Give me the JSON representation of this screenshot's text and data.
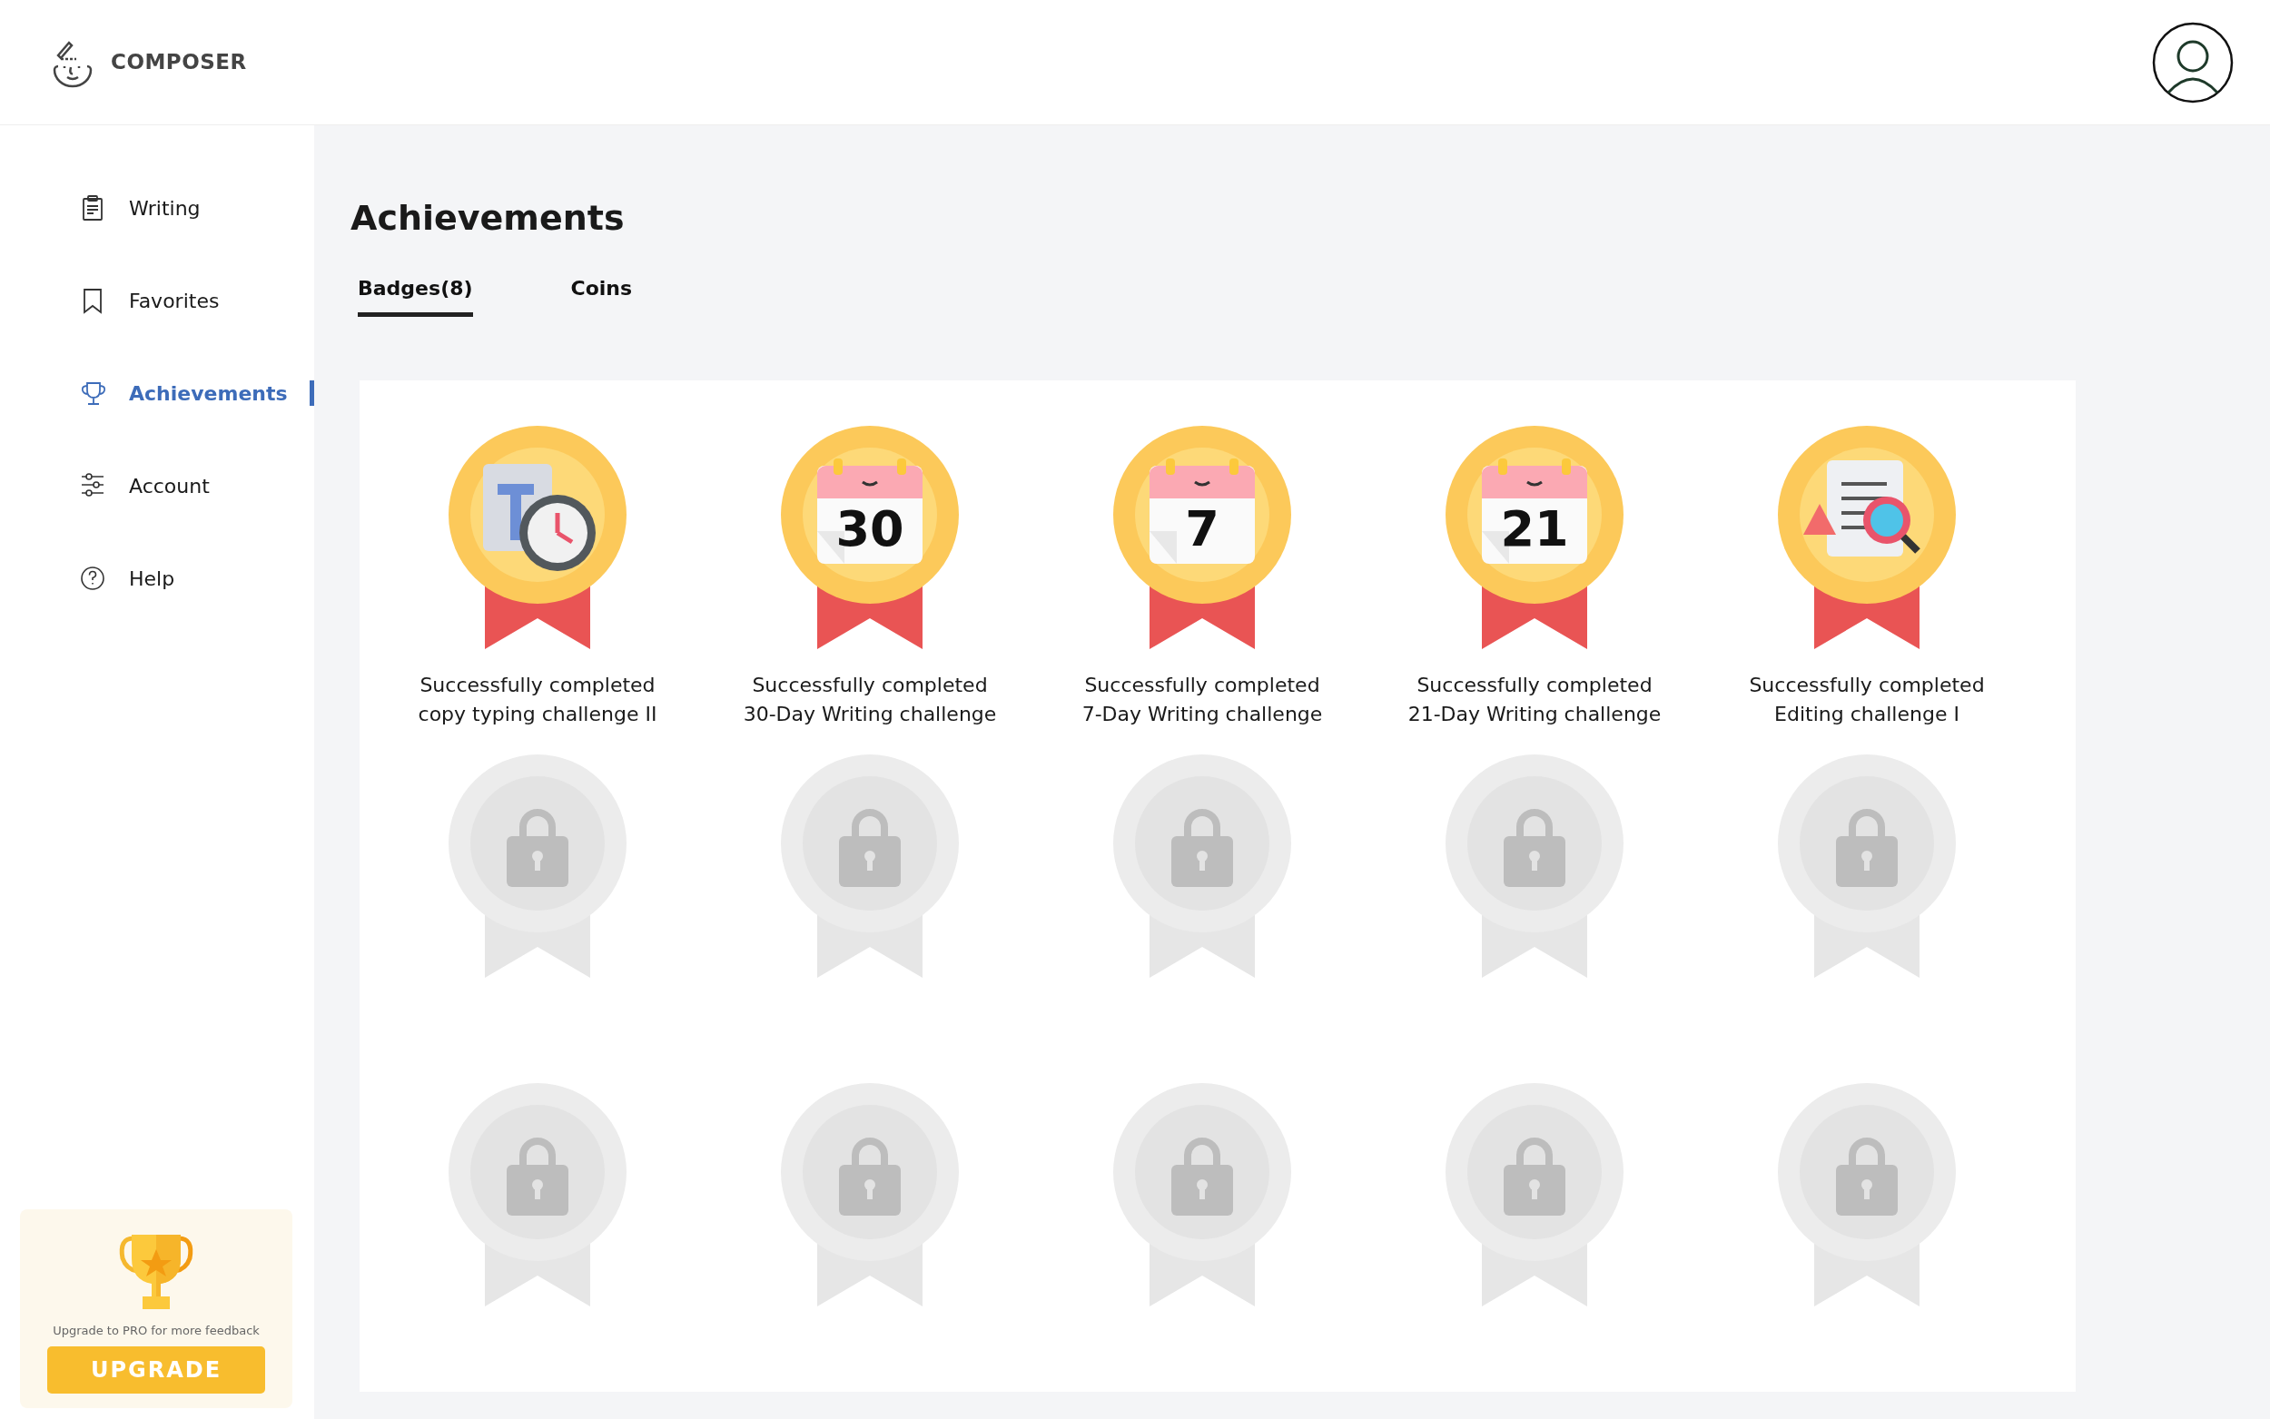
{
  "app": {
    "name": "COMPOSER"
  },
  "sidebar": {
    "items": [
      {
        "label": "Writing",
        "kind": "clipboard",
        "selected": false
      },
      {
        "label": "Favorites",
        "kind": "bookmark",
        "selected": false
      },
      {
        "label": "Achievements",
        "kind": "trophy",
        "selected": true
      },
      {
        "label": "Account",
        "kind": "sliders",
        "selected": false
      },
      {
        "label": "Help",
        "kind": "help",
        "selected": false
      }
    ]
  },
  "upgrade": {
    "text": "Upgrade to PRO for more feedback",
    "button": "UPGRADE"
  },
  "page": {
    "title": "Achievements"
  },
  "tabs": [
    {
      "label": "Badges(8)",
      "selected": true
    },
    {
      "label": "Coins",
      "selected": false
    }
  ],
  "badges": [
    {
      "kind": "clock",
      "caption": [
        "Successfully completed",
        "copy typing challenge II"
      ]
    },
    {
      "kind": "calendar",
      "number": "30",
      "caption": [
        "Successfully completed",
        "30-Day Writing challenge"
      ]
    },
    {
      "kind": "calendar",
      "number": "7",
      "caption": [
        "Successfully completed",
        "7-Day Writing challenge"
      ]
    },
    {
      "kind": "calendar",
      "number": "21",
      "caption": [
        "Successfully completed",
        "21-Day Writing challenge"
      ]
    },
    {
      "kind": "editing",
      "caption": [
        "Successfully completed",
        "Editing challenge I"
      ]
    },
    {
      "kind": "locked"
    },
    {
      "kind": "locked"
    },
    {
      "kind": "locked"
    },
    {
      "kind": "locked"
    },
    {
      "kind": "locked"
    },
    {
      "kind": "locked"
    },
    {
      "kind": "locked"
    },
    {
      "kind": "locked"
    },
    {
      "kind": "locked"
    },
    {
      "kind": "locked"
    }
  ]
}
